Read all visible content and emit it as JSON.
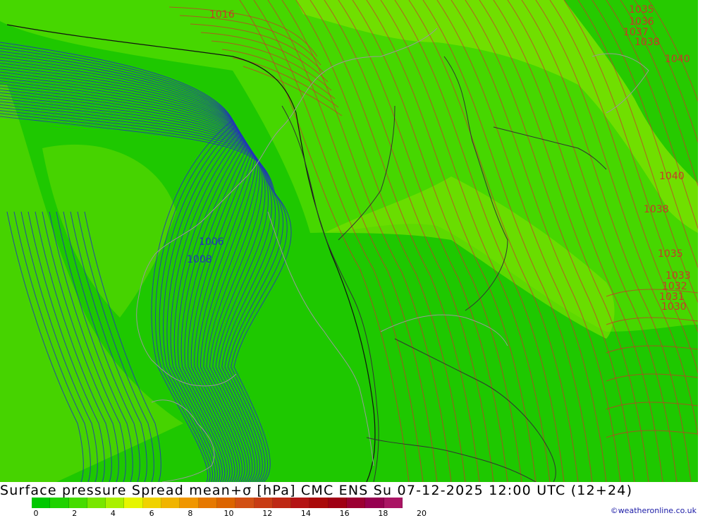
{
  "title": "Surface pressure Spread mean+σ [hPa] CMC ENS Su 07-12-2025 12:00 UTC (12+24)",
  "credit": "©weatheronline.co.uk",
  "legend": {
    "colors": [
      "#00c800",
      "#20d200",
      "#46dc00",
      "#78e600",
      "#aaf000",
      "#e6f500",
      "#f0d200",
      "#f0b400",
      "#f09600",
      "#e67800",
      "#dc6400",
      "#d25014",
      "#c83c14",
      "#be2814",
      "#b41414",
      "#aa0a0a",
      "#a00014",
      "#9c0032",
      "#960050",
      "#aa1464"
    ],
    "ticks": [
      "0",
      "2",
      "4",
      "6",
      "8",
      "10",
      "12",
      "14",
      "16",
      "18",
      "20"
    ]
  },
  "map": {
    "colors": {
      "shade_low": "#1ec800",
      "shade_mid": "#46d700",
      "shade_high": "#78e000",
      "isobar_low": "#2233bb",
      "isobar_high": "#c8372a",
      "isobar_ref": "#111111",
      "coast": "#9a9a9a",
      "border": "#333333"
    },
    "isobar_labels": [
      {
        "text": "1016",
        "group": "low"
      },
      {
        "text": "1006",
        "group": "low"
      },
      {
        "text": "1008",
        "group": "low"
      },
      {
        "text": "1035",
        "group": "high"
      },
      {
        "text": "1036",
        "group": "high"
      },
      {
        "text": "1037",
        "group": "high"
      },
      {
        "text": "1038",
        "group": "high"
      },
      {
        "text": "1040",
        "group": "high"
      },
      {
        "text": "1040",
        "group": "high"
      },
      {
        "text": "1038",
        "group": "high"
      },
      {
        "text": "1035",
        "group": "high"
      },
      {
        "text": "1033",
        "group": "high"
      },
      {
        "text": "1032",
        "group": "high"
      },
      {
        "text": "1031",
        "group": "high"
      },
      {
        "text": "1030",
        "group": "high"
      }
    ]
  }
}
